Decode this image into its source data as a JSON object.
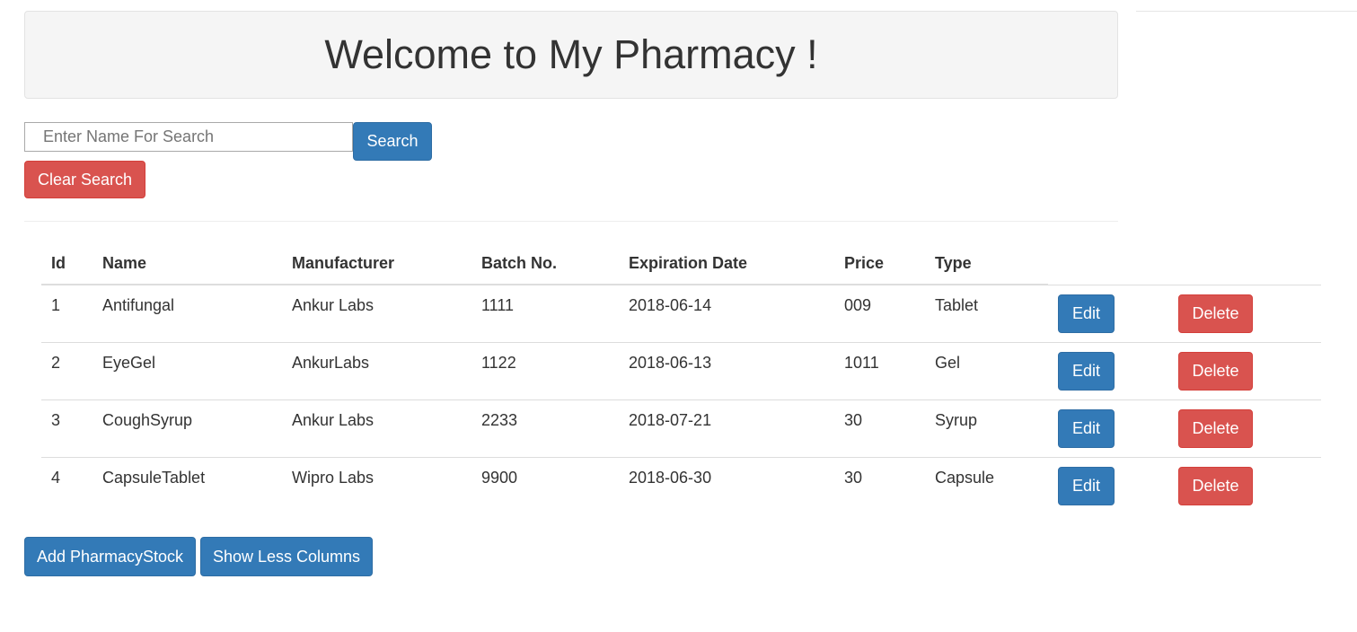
{
  "header": {
    "title": "Welcome to My Pharmacy !"
  },
  "search": {
    "placeholder": "Enter Name For Search",
    "value": "",
    "search_label": "Search",
    "clear_label": "Clear Search"
  },
  "table": {
    "columns": [
      "Id",
      "Name",
      "Manufacturer",
      "Batch No.",
      "Expiration Date",
      "Price",
      "Type"
    ],
    "rows": [
      {
        "id": "1",
        "name": "Antifungal",
        "manufacturer": "Ankur Labs",
        "batch": "1111",
        "expiration": "2018-06-14",
        "price": "009",
        "type": "Tablet",
        "edit_label": "Edit",
        "delete_label": "Delete"
      },
      {
        "id": "2",
        "name": "EyeGel",
        "manufacturer": "AnkurLabs",
        "batch": "1122",
        "expiration": "2018-06-13",
        "price": "1011",
        "type": "Gel",
        "edit_label": "Edit",
        "delete_label": "Delete"
      },
      {
        "id": "3",
        "name": "CoughSyrup",
        "manufacturer": "Ankur Labs",
        "batch": "2233",
        "expiration": "2018-07-21",
        "price": "30",
        "type": "Syrup",
        "edit_label": "Edit",
        "delete_label": "Delete"
      },
      {
        "id": "4",
        "name": "CapsuleTablet",
        "manufacturer": "Wipro Labs",
        "batch": "9900",
        "expiration": "2018-06-30",
        "price": "30",
        "type": "Capsule",
        "edit_label": "Edit",
        "delete_label": "Delete"
      }
    ]
  },
  "footer": {
    "add_label": "Add PharmacyStock",
    "less_columns_label": "Show Less Columns"
  },
  "colors": {
    "primary": "#337ab7",
    "danger": "#d9534f",
    "jumbotron_bg": "#f5f5f5"
  }
}
